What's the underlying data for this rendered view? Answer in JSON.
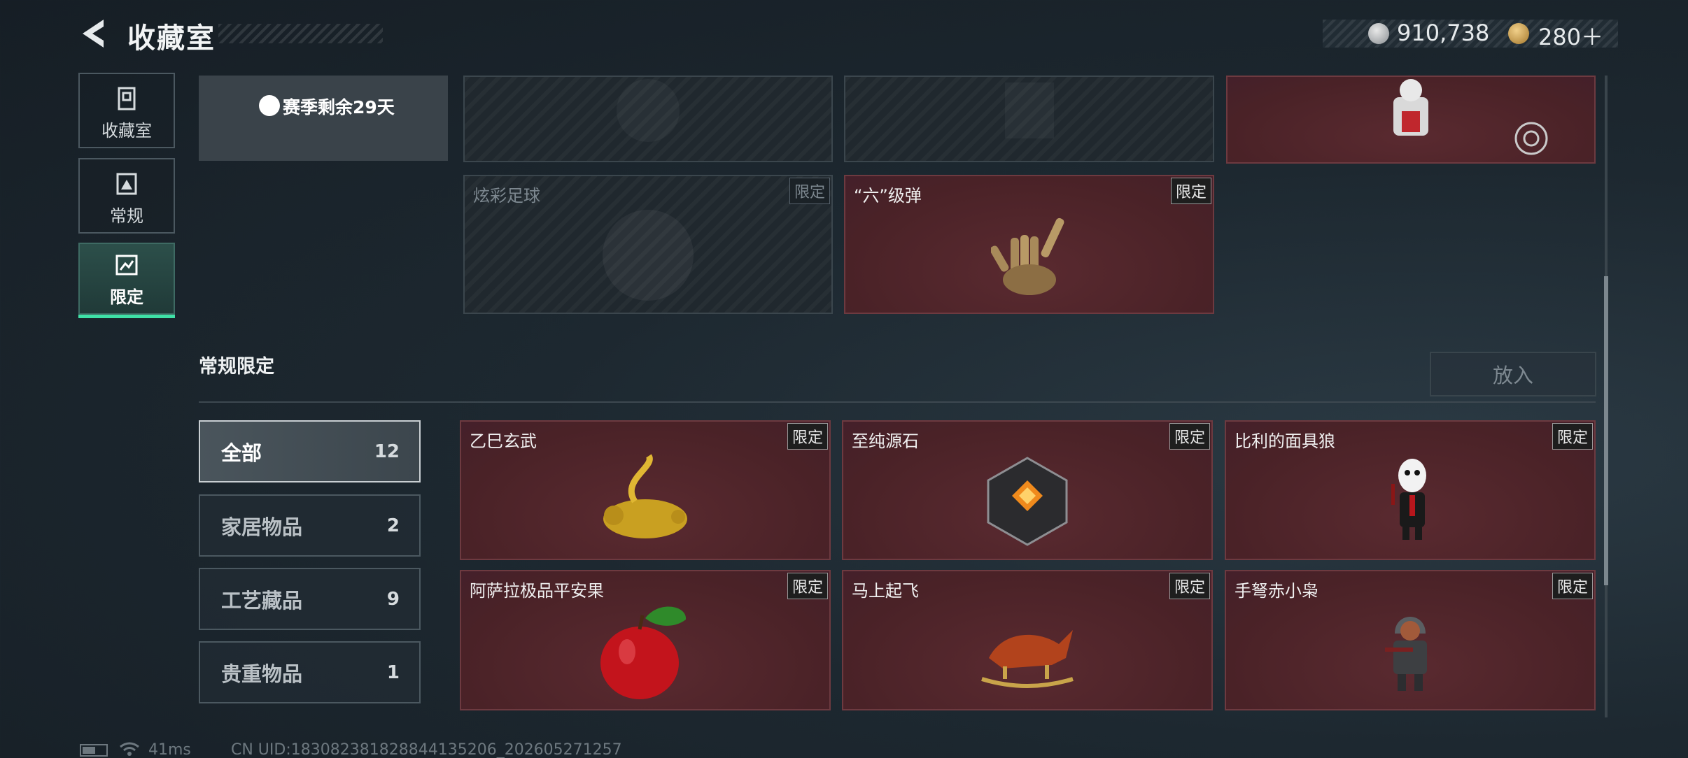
{
  "header": {
    "title": "收藏室",
    "currency1_value": "910,738",
    "currency2_value": "280＋"
  },
  "nav": {
    "items": [
      {
        "label": "收藏室",
        "icon": "collection-room-icon"
      },
      {
        "label": "常规",
        "icon": "regular-icon"
      },
      {
        "label": "限定",
        "icon": "limited-icon"
      }
    ]
  },
  "season": {
    "remaining": "赛季剩余29天"
  },
  "top_cards": [
    {
      "name": "炫彩足球",
      "badge": "限定",
      "style": "dark",
      "owned": false
    },
    {
      "name": "“六”级弹",
      "badge": "限定",
      "style": "red",
      "owned": true
    }
  ],
  "section": {
    "title": "常规限定",
    "put_in_label": "放入"
  },
  "categories": [
    {
      "label": "全部",
      "count": "12"
    },
    {
      "label": "家居物品",
      "count": "2"
    },
    {
      "label": "工艺藏品",
      "count": "9"
    },
    {
      "label": "贵重物品",
      "count": "1"
    }
  ],
  "items": [
    {
      "name": "乙巳玄武",
      "badge": "限定"
    },
    {
      "name": "至纯源石",
      "badge": "限定"
    },
    {
      "name": "比利的面具狼",
      "badge": "限定"
    },
    {
      "name": "阿萨拉极品平安果",
      "badge": "限定"
    },
    {
      "name": "马上起飞",
      "badge": "限定"
    },
    {
      "name": "手弩赤小枭",
      "badge": "限定"
    }
  ],
  "footer": {
    "ping": "41ms",
    "uid": "CN UID:18308238182884413520​6_202605271257"
  },
  "colors": {
    "accent": "#3fe0a6",
    "card_red": "#4a2227",
    "card_dark": "#20282e"
  }
}
